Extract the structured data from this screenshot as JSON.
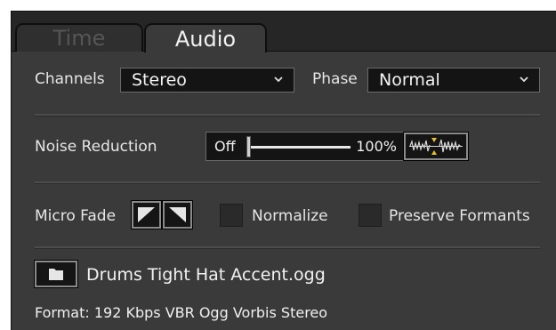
{
  "tabs": [
    {
      "label": "Time",
      "active": false
    },
    {
      "label": "Audio",
      "active": true
    }
  ],
  "channels": {
    "label": "Channels",
    "value": "Stereo"
  },
  "phase": {
    "label": "Phase",
    "value": "Normal"
  },
  "noise_reduction": {
    "label": "Noise Reduction",
    "min_label": "Off",
    "max_label": "100%",
    "value_fraction": 0
  },
  "micro_fade": {
    "label": "Micro Fade"
  },
  "normalize": {
    "label": "Normalize",
    "checked": false
  },
  "preserve_formants": {
    "label": "Preserve Formants",
    "checked": false
  },
  "file": {
    "name": "Drums Tight Hat Accent.ogg",
    "format": "Format: 192 Kbps VBR Ogg Vorbis Stereo"
  },
  "colors": {
    "panel": "#3a3a3a",
    "tabstrip": "#262626",
    "field": "#141414",
    "waveform_marker": "#e8c12a"
  }
}
